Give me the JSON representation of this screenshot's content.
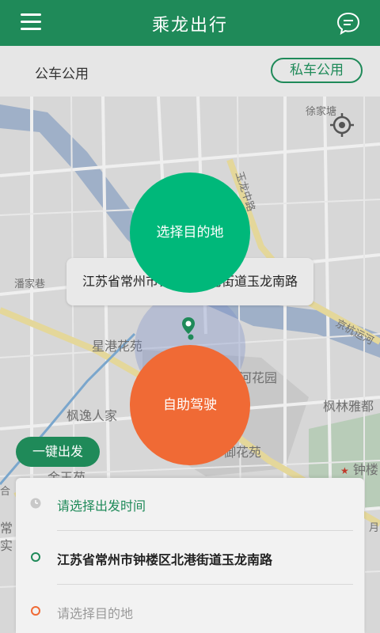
{
  "header": {
    "title": "乘龙出行",
    "menu_icon": "menu-icon",
    "chat_icon": "chat-bubble-icon"
  },
  "subbar": {
    "public_label": "公车公用",
    "private_button": "私车公用"
  },
  "map": {
    "labels": {
      "xujiatang": "徐家塘",
      "yulong_mid": "玉龙中路",
      "panjiaxiang": "潘家巷",
      "xinggang": "星港花苑",
      "jinghang": "京杭运河",
      "flower_garden": "河花园",
      "fenglin": "枫林雅都",
      "fengyi": "枫逸人家",
      "huayuan": "御花苑",
      "jinyu": "金玉苑",
      "zhonglou": "钟楼",
      "chang": "常",
      "shi": "实",
      "ge": "合",
      "yue": "月"
    },
    "address_bubble": "江苏省常州市钟楼区北港街道玉龙南路",
    "locate_icon": "locate-crosshair-icon",
    "pin_icon": "map-pin-icon"
  },
  "actions": {
    "choose_destination": "选择目的地",
    "self_drive": "自助驾驶",
    "one_key_depart": "一键出发"
  },
  "panel": {
    "time_placeholder": "请选择出发时间",
    "origin": "江苏省常州市钟楼区北港街道玉龙南路",
    "destination_placeholder": "请选择目的地"
  },
  "colors": {
    "primary": "#1f8a59",
    "accent_green": "#00b87a",
    "accent_orange": "#f06a35"
  }
}
